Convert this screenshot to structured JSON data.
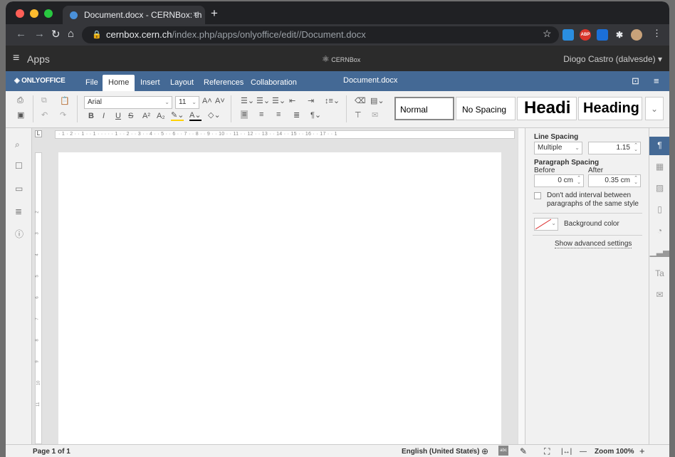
{
  "browser": {
    "tab_title": "Document.docx - CERNBox: th",
    "tab_close": "×",
    "new_tab": "+",
    "url_host": "cernbox.cern.ch",
    "url_path": "/index.php/apps/onlyoffice/edit//Document.docx",
    "ext_abp": "ABP"
  },
  "apps_bar": {
    "apps_label": "Apps",
    "brand": "CERNBox",
    "user": "Diogo Castro (dalvesde) ▾"
  },
  "oo": {
    "logo": "ONLYOFFICE",
    "tabs": [
      "File",
      "Home",
      "Insert",
      "Layout",
      "References",
      "Collaboration"
    ],
    "active_tab": "Home",
    "doc_name": "Document.docx"
  },
  "toolbar": {
    "font_name": "Arial",
    "font_size": "11",
    "styles": [
      "Normal",
      "No Spacing",
      "Headi",
      "Heading"
    ]
  },
  "ruler": {
    "corner": "L",
    "numbers": "· 1 · 2 · · 1 · · 1 · · · · · 1 · · 2 · · 3 · · 4 · · 5 · · 6 · · 7 · · 8 · · 9 · · 10 · · 11 · · 12 · · 13 · · 14 · · 15 · · 16 · · 17 · · 1",
    "vnumbers": [
      "2",
      "3",
      "4",
      "5",
      "6",
      "7",
      "8",
      "9",
      "10",
      "11"
    ]
  },
  "panel": {
    "line_spacing_title": "Line Spacing",
    "line_spacing_mode": "Multiple",
    "line_spacing_value": "1.15",
    "paragraph_spacing_title": "Paragraph Spacing",
    "before_label": "Before",
    "after_label": "After",
    "before_value": "0 cm",
    "after_value": "0.35 cm",
    "no_interval_label": "Don't add interval between paragraphs of the same style",
    "background_color_label": "Background color",
    "advanced_label": "Show advanced settings"
  },
  "status": {
    "page": "Page 1 of 1",
    "language": "English (United States)",
    "zoom": "Zoom 100%",
    "zoom_minus": "—",
    "zoom_plus": "+"
  },
  "colors": {
    "onlyoffice_blue": "#446995",
    "chrome_dark": "#202124",
    "apps_bar": "#2b2b2b"
  }
}
